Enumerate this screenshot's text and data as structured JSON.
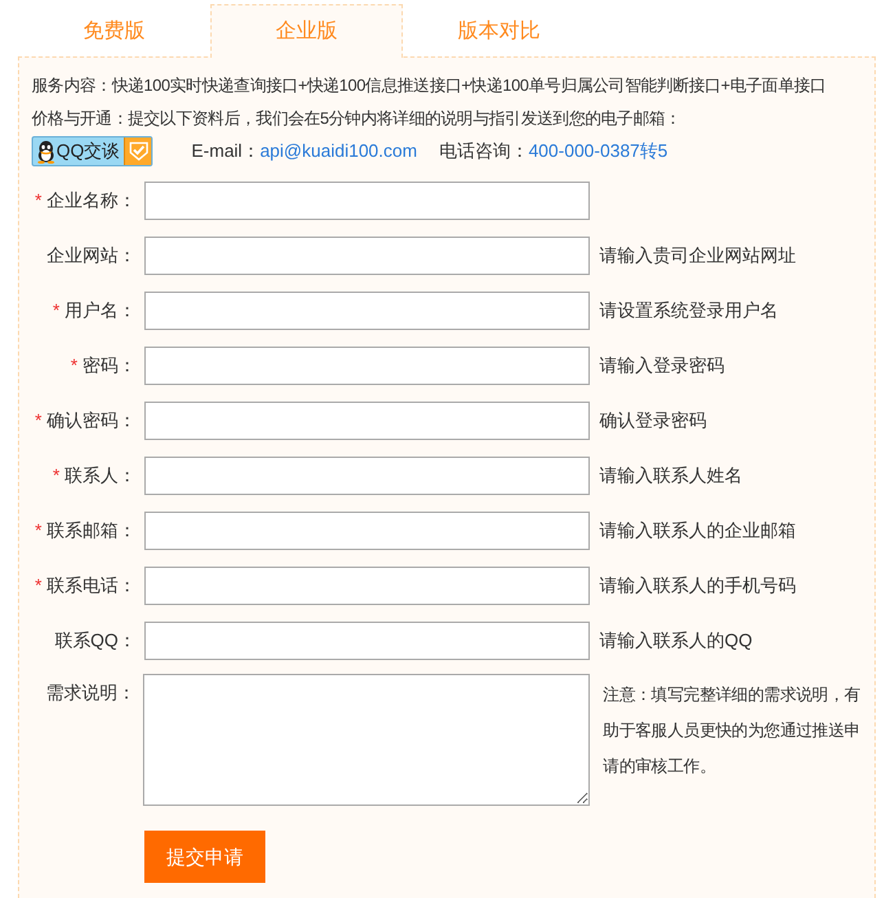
{
  "tabs": [
    {
      "label": "免费版",
      "selected": false
    },
    {
      "label": "企业版",
      "selected": true
    },
    {
      "label": "版本对比",
      "selected": false
    }
  ],
  "info": {
    "service": "服务内容：快递100实时快递查询接口+快递100信息推送接口+快递100单号归属公司智能判断接口+电子面单接口",
    "price": "价格与开通：提交以下资料后，我们会在5分钟内将详细的说明与指引发送到您的电子邮箱：",
    "qq_button": "QQ交谈",
    "email_label": "E-mail：",
    "email": "api@kuaidi100.com",
    "phone_label": "电话咨询：",
    "phone": "400-000-0387转5"
  },
  "fields": [
    {
      "kind": "input",
      "required_mark": "*",
      "label": "企业名称："
    },
    {
      "kind": "input",
      "label": "企业网站：",
      "hint": "请输入贵司企业网站网址"
    },
    {
      "kind": "input",
      "required_mark": "*",
      "label": "用户名：",
      "hint": "请设置系统登录用户名"
    },
    {
      "kind": "input",
      "required_mark": "*",
      "label": "密码：",
      "hint": "请输入登录密码"
    },
    {
      "kind": "input",
      "required_mark": "*",
      "label": "确认密码：",
      "hint": "确认登录密码"
    },
    {
      "kind": "input",
      "required_mark": "*",
      "label": "联系人：",
      "hint": "请输入联系人姓名"
    },
    {
      "kind": "input",
      "required_mark": "*",
      "label": "联系邮箱：",
      "hint": "请输入联系人的企业邮箱"
    },
    {
      "kind": "input",
      "required_mark": "*",
      "label": "联系电话：",
      "hint": "请输入联系人的手机号码"
    },
    {
      "kind": "input",
      "label": "联系QQ：",
      "hint": "请输入联系人的QQ"
    },
    {
      "kind": "textarea",
      "label": "需求说明：",
      "hint": "注意：填写完整详细的需求说明，有助于客服人员更快的为您通过推送申请的审核工作。"
    }
  ],
  "submit": "提交申请"
}
